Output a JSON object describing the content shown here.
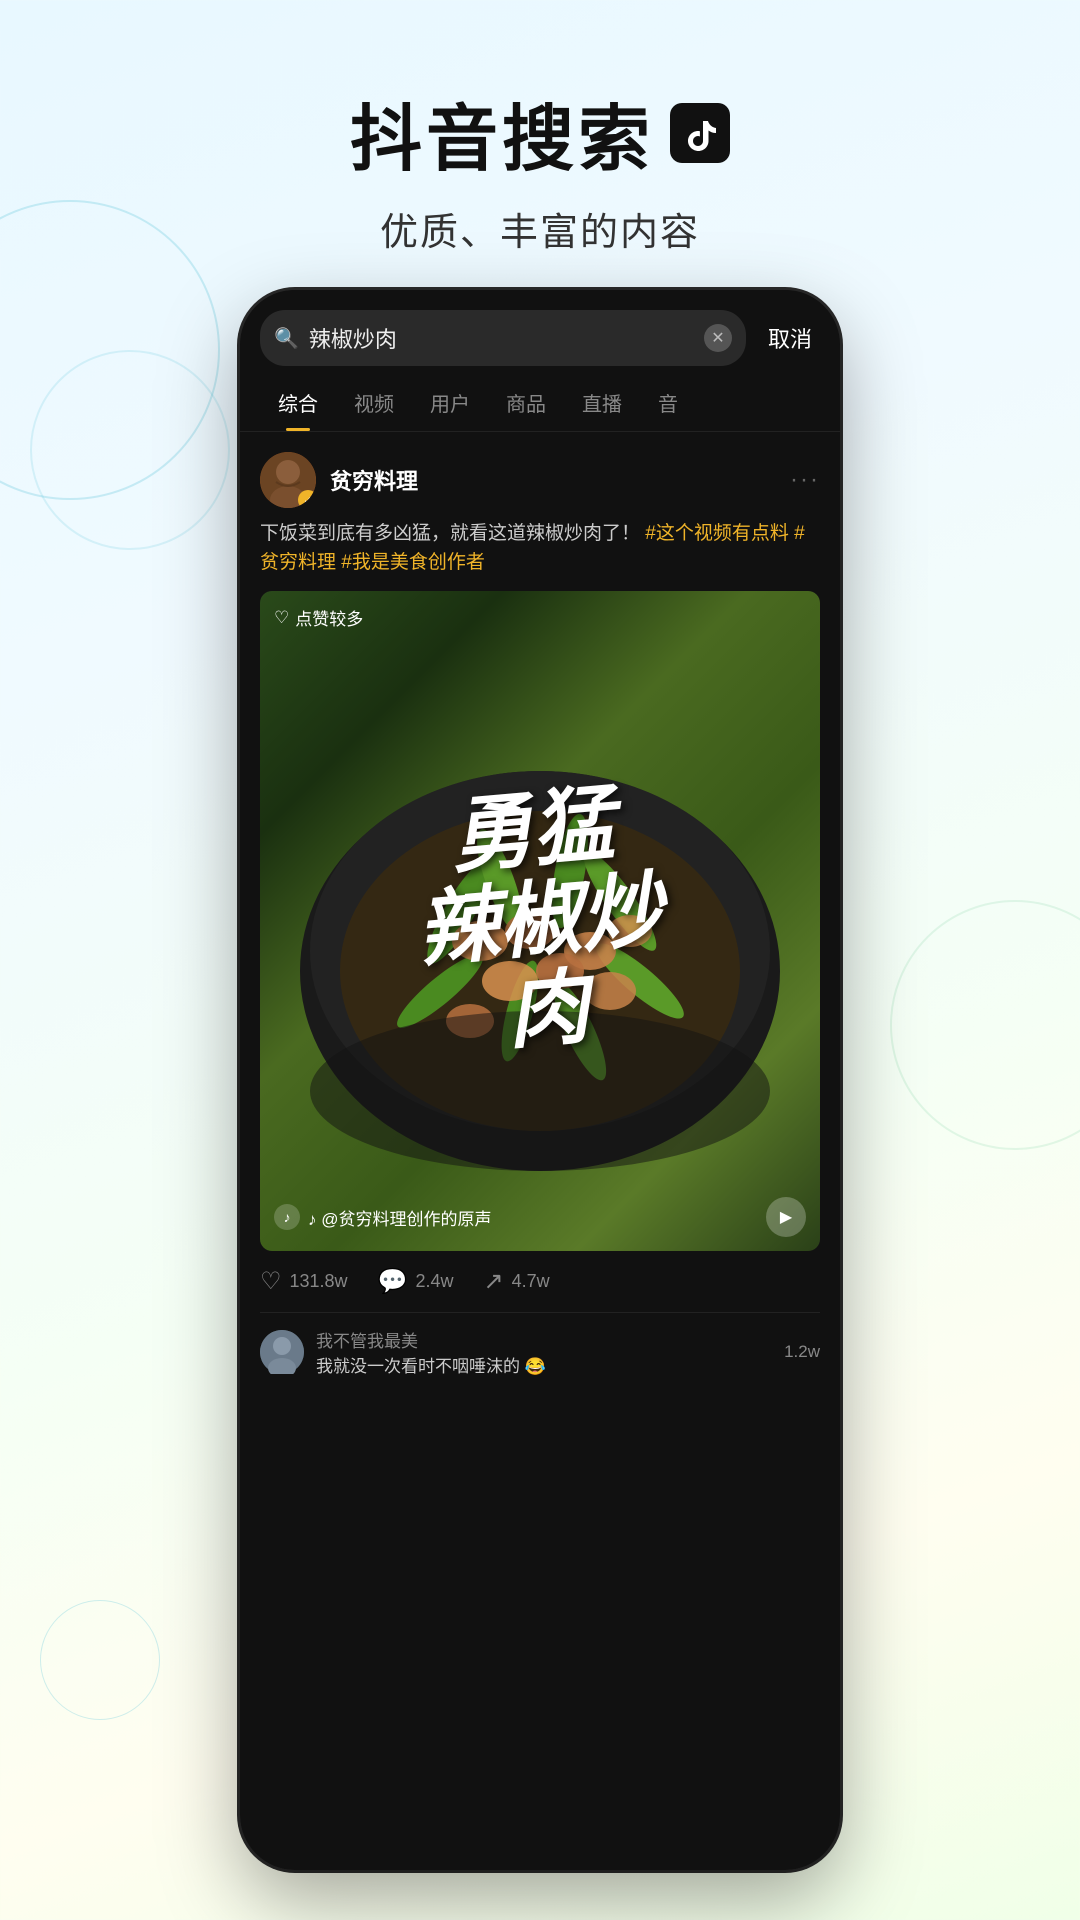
{
  "header": {
    "main_title": "抖音搜索",
    "subtitle": "优质、丰富的内容",
    "tiktok_icon_label": "TikTok Logo"
  },
  "search_bar": {
    "query": "辣椒炒肉",
    "cancel_label": "取消",
    "clear_label": "×"
  },
  "tabs": [
    {
      "label": "综合",
      "active": true
    },
    {
      "label": "视频",
      "active": false
    },
    {
      "label": "用户",
      "active": false
    },
    {
      "label": "商品",
      "active": false
    },
    {
      "label": "直播",
      "active": false
    },
    {
      "label": "音",
      "active": false
    }
  ],
  "post": {
    "username": "贫穷料理",
    "verified": true,
    "body_text": "下饭菜到底有多凶猛，就看这道辣椒炒肉了！",
    "hashtags": [
      "#这个视频有点料",
      "#贫穷料理",
      "#我是美食创作者"
    ],
    "likes_badge": "点赞较多",
    "video_title": "勇猛辣椒炒肉",
    "audio_info": "♪ @贫穷料理创作的原声",
    "actions": {
      "likes": "131.8w",
      "comments": "2.4w",
      "shares": "4.7w"
    }
  },
  "comments": [
    {
      "username": "我不管我最美",
      "text": "我就没一次看时不咽唾沫的 😂",
      "count": "1.2w"
    }
  ],
  "icons": {
    "search": "🔍",
    "clear": "✕",
    "more": "···",
    "heart": "♡",
    "comment": "💬",
    "share": "↗",
    "play": "▶",
    "music": "♪",
    "verified_badge": "✓"
  }
}
